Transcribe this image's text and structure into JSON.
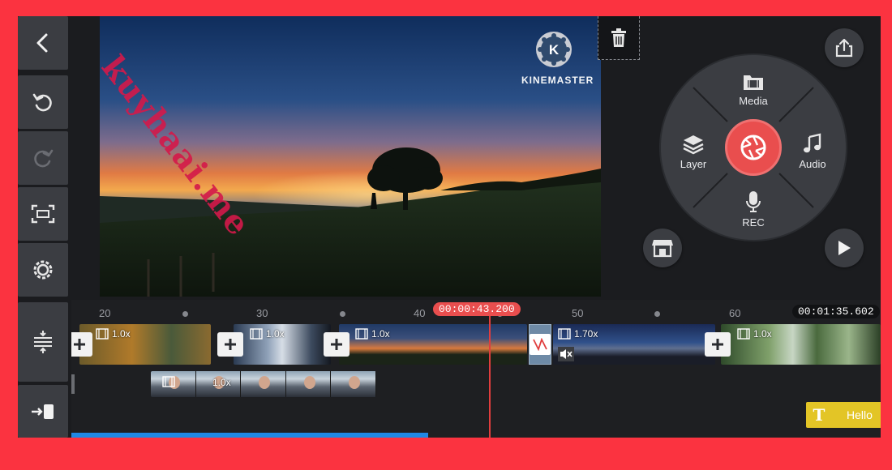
{
  "app": {
    "brand_name": "KINEMASTER",
    "brand_letter": "K",
    "accent_color": "#e94e4e",
    "frame_color": "#fb3340"
  },
  "watermark": {
    "text": "kuyhaai.me"
  },
  "toolbar": {
    "back_icon": "back-arrow-icon",
    "undo_icon": "undo-icon",
    "redo_icon": "redo-icon",
    "crop_icon": "crop-frame-icon",
    "settings_icon": "settings-gear-icon",
    "timeline_expand_icon": "timeline-expand-icon",
    "jump_end_icon": "jump-to-end-icon"
  },
  "media_wheel": {
    "media_label": "Media",
    "audio_label": "Audio",
    "layer_label": "Layer",
    "rec_label": "REC"
  },
  "timeline": {
    "current_time": "00:00:43.200",
    "total_time": "00:01:35.602",
    "ruler": [
      "20",
      "30",
      "40",
      "50",
      "60"
    ],
    "clip_speeds": [
      "1.0x",
      "1.0x",
      "1.0x",
      "1.70x",
      "1.0x"
    ],
    "overlay_speed": "1.0x",
    "text_layer_label": "Hello"
  }
}
